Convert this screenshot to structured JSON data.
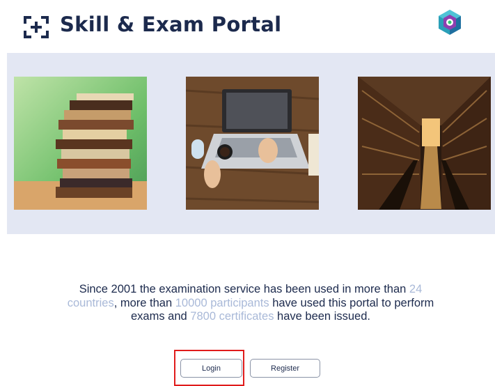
{
  "header": {
    "title": "Skill & Exam Portal",
    "logo_icon": "bracketed-plus-icon",
    "brand_icon": "hexagon-network-icon"
  },
  "gallery": {
    "images": [
      "stack-of-books",
      "laptop-on-wooden-desk",
      "library-hall"
    ]
  },
  "intro": {
    "part1": "Since 2001 the examination service has been used in more than ",
    "countries": "24 countries",
    "part2": ", more than ",
    "participants": "10000 participants",
    "part3": " have used this portal to perform exams and ",
    "certificates": "7800 certificates",
    "part4": " have been issued."
  },
  "actions": {
    "login_label": "Login",
    "register_label": "Register"
  },
  "colors": {
    "primary_text": "#1c2a4d",
    "highlight": "#a9b9d8",
    "band_background": "#e3e7f3",
    "focus_outline": "#e01b1b"
  }
}
